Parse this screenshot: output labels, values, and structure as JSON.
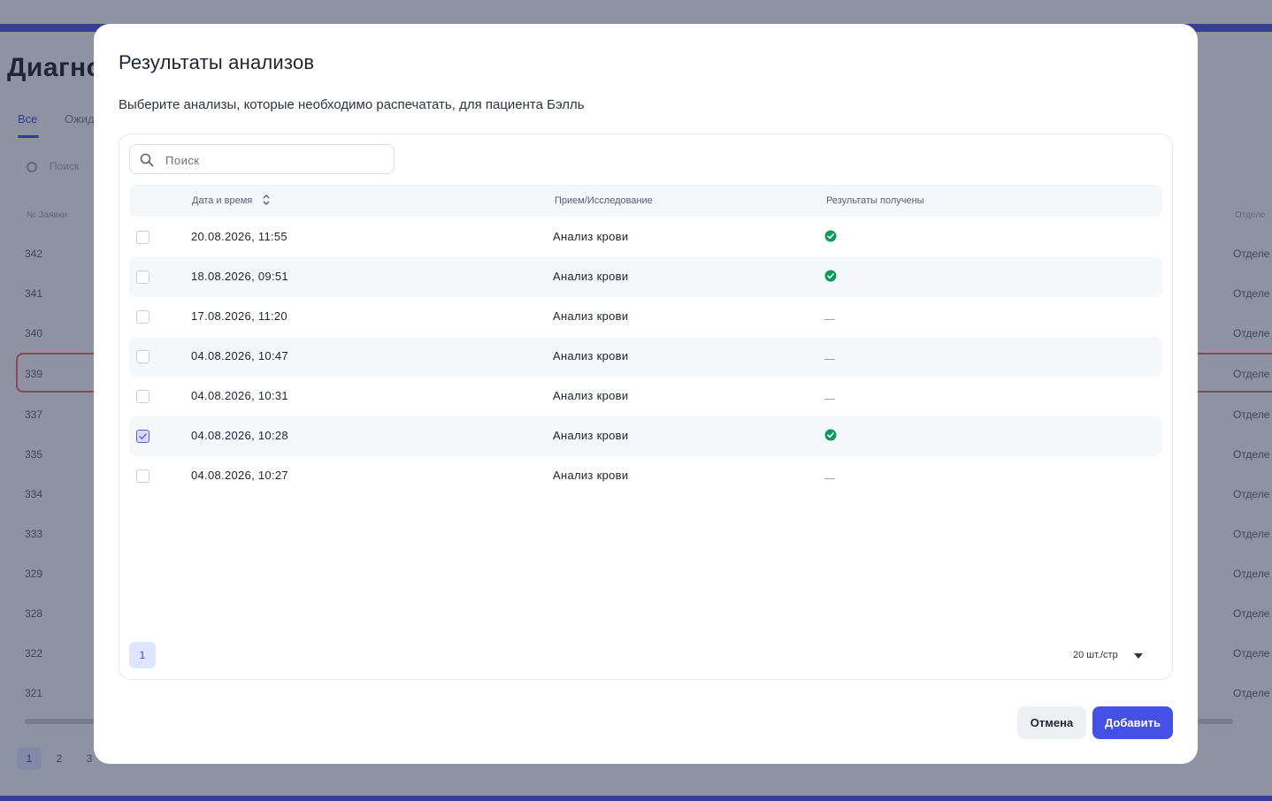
{
  "background": {
    "page_title": "Диагно",
    "tabs": [
      "Все",
      "Ожид"
    ],
    "search_placeholder": "Поиск",
    "col_order_header": "№ Заявки",
    "col_dept_header": "Отделе",
    "rows": [
      {
        "num": "342",
        "dept": "Отделе"
      },
      {
        "num": "341",
        "dept": "Отделе"
      },
      {
        "num": "340",
        "dept": "Отделе"
      },
      {
        "num": "339",
        "dept": "Отделе"
      },
      {
        "num": "337",
        "dept": "Отделе"
      },
      {
        "num": "335",
        "dept": "Отделе"
      },
      {
        "num": "334",
        "dept": "Отделе"
      },
      {
        "num": "333",
        "dept": "Отделе"
      },
      {
        "num": "329",
        "dept": "Отделе"
      },
      {
        "num": "328",
        "dept": "Отделе"
      },
      {
        "num": "322",
        "dept": "Отделе"
      },
      {
        "num": "321",
        "dept": "Отделе"
      }
    ],
    "pages": [
      "1",
      "2",
      "3"
    ]
  },
  "modal": {
    "title": "Результаты анализов",
    "subtitle": "Выберите анализы, которые необходимо распечатать, для пациента Бэлль",
    "search_placeholder": "Поиск",
    "columns": {
      "date": "Дата и время",
      "study": "Прием/Исследование",
      "results": "Результаты получены"
    },
    "rows": [
      {
        "date": "20.08.2026, 11:55",
        "study": "Анализ крови",
        "results_received": true,
        "checked": false
      },
      {
        "date": "18.08.2026, 09:51",
        "study": "Анализ крови",
        "results_received": true,
        "checked": false
      },
      {
        "date": "17.08.2026, 11:20",
        "study": "Анализ крови",
        "results_received": false,
        "checked": false
      },
      {
        "date": "04.08.2026, 10:47",
        "study": "Анализ крови",
        "results_received": false,
        "checked": false
      },
      {
        "date": "04.08.2026, 10:31",
        "study": "Анализ крови",
        "results_received": false,
        "checked": false
      },
      {
        "date": "04.08.2026, 10:28",
        "study": "Анализ крови",
        "results_received": true,
        "checked": true
      },
      {
        "date": "04.08.2026, 10:27",
        "study": "Анализ крови",
        "results_received": false,
        "checked": false
      }
    ],
    "pagination": {
      "current_page": "1",
      "per_page": "20 шт./стр"
    },
    "buttons": {
      "cancel": "Отмена",
      "add": "Добавить"
    },
    "icons": {
      "search": "search-icon",
      "sort": "sort-icon",
      "success": "check-circle-icon",
      "caret": "caret-down-icon"
    },
    "colors": {
      "accent": "#4450e6",
      "success": "#0a9a5c"
    }
  }
}
